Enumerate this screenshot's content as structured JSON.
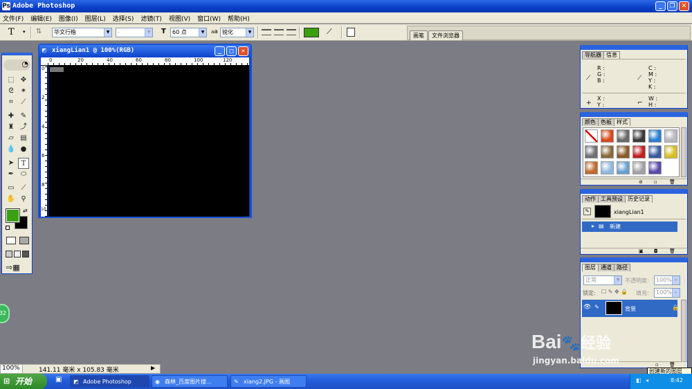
{
  "window": {
    "title": "Adobe Photoshop",
    "app_icon": "Ps"
  },
  "menu": [
    "文件(F)",
    "编辑(E)",
    "图像(I)",
    "图层(L)",
    "选择(S)",
    "滤镜(T)",
    "视图(V)",
    "窗口(W)",
    "帮助(H)"
  ],
  "options": {
    "tool_glyph": "T",
    "font_family": "华文行楷",
    "font_style": "-",
    "font_size": "60 点",
    "aa_label": "a",
    "anti_alias": "锐化",
    "text_color": "#3aa012"
  },
  "palette_well": [
    "画笔",
    "文件浏览器"
  ],
  "document": {
    "title": "xiangLian1 @ 100%(RGB)",
    "ruler_h": [
      "0",
      "20",
      "40",
      "60",
      "80",
      "100",
      "120"
    ],
    "ruler_v": [
      "0",
      "2",
      "4",
      "6",
      "8",
      "10"
    ]
  },
  "toolbox": {
    "foreground": "#3aa012",
    "background": "#000000"
  },
  "info_panel": {
    "tabs": [
      "导航器",
      "信息"
    ],
    "rgb": [
      "R",
      "G",
      "B"
    ],
    "cmyk": [
      "C",
      "M",
      "Y",
      "K"
    ],
    "xy": [
      "X",
      "Y"
    ],
    "wh": [
      "W",
      "H"
    ],
    "colon": ":"
  },
  "styles_panel": {
    "tabs": [
      "颜色",
      "色板",
      "样式"
    ],
    "styles": [
      "#ffffff",
      "#d84a1a",
      "#6a6a6a",
      "#3a3a3a",
      "#2a7ed0",
      "#b8b8c0",
      "#707070",
      "#8a6a3a",
      "#8a5a2a",
      "#c02020",
      "#3a5aa0",
      "#d8c020",
      "#c06a30",
      "#90b8e0",
      "#6aa0d0",
      "#a0a0a8",
      "#5a4aa8"
    ]
  },
  "history_panel": {
    "tabs": [
      "动作",
      "工具预设",
      "历史记录"
    ],
    "snapshot": "xiangLian1",
    "step": "新建"
  },
  "layers_panel": {
    "tabs": [
      "图层",
      "通道",
      "路径"
    ],
    "blend": "正常",
    "opacity_label": "不透明度:",
    "opacity": "100%",
    "lock_label": "锁定:",
    "fill_label": "填充:",
    "fill": "100%",
    "layer_name": "背景"
  },
  "tooltip": "创建新的图层",
  "status": {
    "zoom": "100%",
    "doc_size": "141.11 毫米 x 105.83 毫米"
  },
  "taskbar": {
    "start": "开始",
    "tasks": [
      "Adobe Photoshop",
      "森林_百度图片搜...",
      "xiang2.JPG - 画图"
    ],
    "time": "8:42"
  },
  "badge": "32",
  "watermark": {
    "brand": "Bai",
    "brand2": "经验",
    "url": "jingyan.baidu.com"
  }
}
